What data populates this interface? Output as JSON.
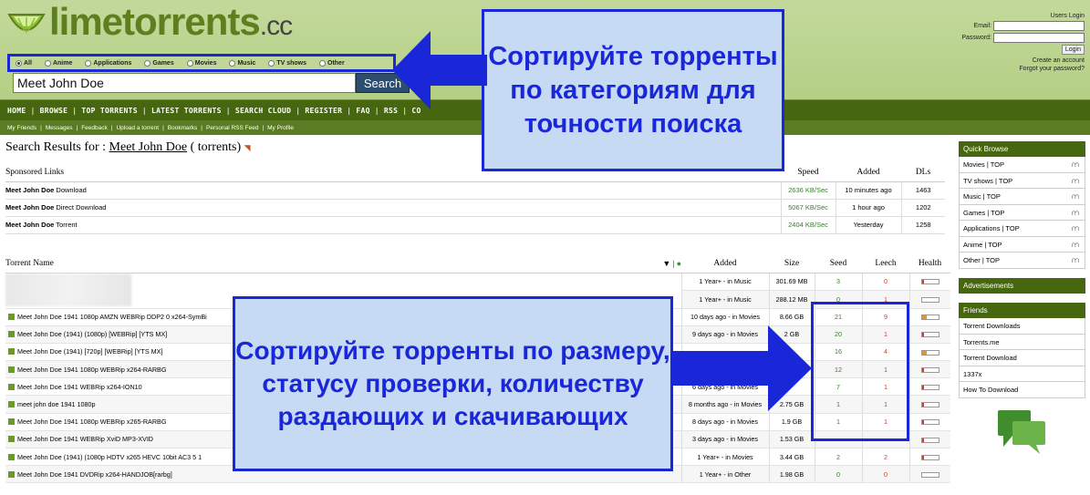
{
  "logo": {
    "name": "limetorrents",
    "tld": ".cc"
  },
  "categories": [
    {
      "label": "All",
      "selected": true
    },
    {
      "label": "Anime",
      "selected": false
    },
    {
      "label": "Applications",
      "selected": false
    },
    {
      "label": "Games",
      "selected": false
    },
    {
      "label": "Movies",
      "selected": false
    },
    {
      "label": "Music",
      "selected": false
    },
    {
      "label": "TV shows",
      "selected": false
    },
    {
      "label": "Other",
      "selected": false
    }
  ],
  "search": {
    "value": "Meet John Doe",
    "button": "Search"
  },
  "login": {
    "title": "Users Login",
    "email_label": "Email:",
    "password_label": "Password:",
    "button": "Login",
    "create": "Create an account",
    "forgot": "Forgot your password?"
  },
  "nav": [
    "HOME",
    "BROWSE",
    "TOP TORRENTS",
    "LATEST TORRENTS",
    "SEARCH CLOUD",
    "REGISTER",
    "FAQ",
    "RSS",
    "CO"
  ],
  "subnav": [
    "My Friends",
    "Messages",
    "Feedback",
    "Upload a torrent",
    "Bookmarks",
    "Personal RSS Feed",
    "My Profile"
  ],
  "results": {
    "prefix": "Search Results for : ",
    "query": "Meet John Doe",
    "suffix": " ( torrents)"
  },
  "sponsored": {
    "headers": [
      "Sponsored Links",
      "Speed",
      "Added",
      "DLs"
    ],
    "rows": [
      {
        "bold": "Meet John Doe",
        "rest": " Download",
        "speed": "2636 KB/Sec",
        "added": "10 minutes ago",
        "dls": "1463"
      },
      {
        "bold": "Meet John Doe",
        "rest": " Direct Download",
        "speed": "5067 KB/Sec",
        "added": "1 hour ago",
        "dls": "1202"
      },
      {
        "bold": "Meet John Doe",
        "rest": " Torrent",
        "speed": "2404 KB/Sec",
        "added": "Yesterday",
        "dls": "1258"
      }
    ]
  },
  "torrents": {
    "headers": {
      "name": "Torrent Name",
      "added": "Added",
      "size": "Size",
      "seed": "Seed",
      "leech": "Leech",
      "health": "Health"
    },
    "rows": [
      {
        "name": "",
        "added": "1 Year+ - in Music",
        "size": "301.69 MB",
        "seed": "3",
        "leech": "0",
        "health": 0.1,
        "dl": false
      },
      {
        "name": "",
        "added": "1 Year+ - in Music",
        "size": "288.12 MB",
        "seed": "0",
        "leech": "1",
        "health": 0,
        "dl": false
      },
      {
        "name": "Meet John Doe 1941 1080p AMZN WEBRip DDP2 0 x264-SymBi",
        "added": "10 days ago - in Movies",
        "size": "8.66 GB",
        "seed": "21",
        "leech": "9",
        "health": 0.3,
        "dl": true
      },
      {
        "name": "Meet John Doe (1941) (1080p) [WEBRip] [YTS MX]",
        "added": "9 days ago - in Movies",
        "size": "2 GB",
        "seed": "20",
        "leech": "1",
        "health": 0.1,
        "dl": true
      },
      {
        "name": "Meet John Doe (1941) [720p] [WEBRip] [YTS MX]",
        "added": "",
        "size": "",
        "seed": "16",
        "leech": "4",
        "health": 0.3,
        "dl": true
      },
      {
        "name": "Meet John Doe 1941 1080p WEBRip x264-RARBG",
        "added": "",
        "size": "",
        "seed": "12",
        "leech": "1",
        "health": 0.1,
        "dl": true
      },
      {
        "name": "Meet John Doe 1941 WEBRip x264-ION10",
        "added": "6 days ago - in Movies",
        "size": "",
        "seed": "7",
        "leech": "1",
        "health": 0.1,
        "dl": true
      },
      {
        "name": "meet john doe 1941 1080p",
        "added": "8 months ago - in Movies",
        "size": "2.75 GB",
        "seed": "1",
        "leech": "1",
        "health": 0.1,
        "dl": true
      },
      {
        "name": "Meet John Doe 1941 1080p WEBRip x265-RARBG",
        "added": "8 days ago - in Movies",
        "size": "1.9 GB",
        "seed": "1",
        "leech": "1",
        "health": 0.1,
        "dl": true
      },
      {
        "name": "Meet John Doe 1941 WEBRip XviD MP3-XVID",
        "added": "3 days ago - in Movies",
        "size": "1.53 GB",
        "seed": "",
        "leech": "",
        "health": 0.1,
        "dl": true
      },
      {
        "name": "Meet John Doe (1941) (1080p HDTV x265 HEVC 10bit AC3 5 1",
        "added": "1 Year+ - in Movies",
        "size": "3.44 GB",
        "seed": "2",
        "leech": "2",
        "health": 0.1,
        "dl": true
      },
      {
        "name": "Meet John Doe 1941 DVDRip x264-HANDJOB[rarbg]",
        "added": "1 Year+ - in Other",
        "size": "1.98 GB",
        "seed": "0",
        "leech": "0",
        "health": 0,
        "dl": true
      }
    ]
  },
  "sidebar": {
    "quick_title": "Quick Browse",
    "quick": [
      "Movies | TOP",
      "TV shows | TOP",
      "Music | TOP",
      "Games | TOP",
      "Applications | TOP",
      "Anime | TOP",
      "Other | TOP"
    ],
    "ads_title": "Advertisements",
    "friends_title": "Friends",
    "friends": [
      "Torrent Downloads",
      "Torrents.me",
      "Torrent Download",
      "1337x",
      "How To Download"
    ]
  },
  "callouts": {
    "top": "Сортируйте торренты по категориям для точности поиска",
    "bottom": "Сортируйте торренты по размеру, статусу проверки, количеству раздающих и скачивающих"
  },
  "colors": {
    "callout_border": "#1a27d9",
    "callout_bg": "#c6daf3",
    "nav": "#46660f",
    "header": "#b4cf85"
  }
}
